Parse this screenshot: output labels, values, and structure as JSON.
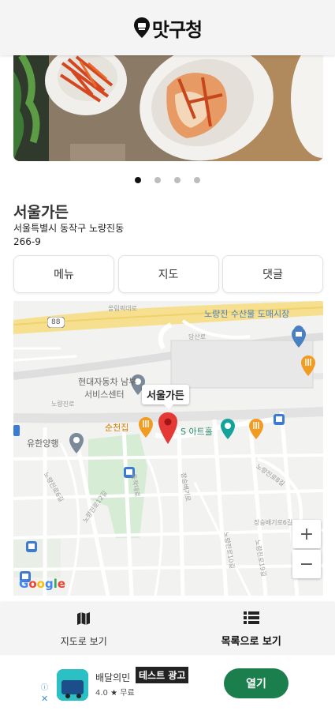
{
  "header": {
    "title": "맛구청"
  },
  "carousel": {
    "total": 4,
    "active_index": 0
  },
  "place": {
    "name": "서울가든",
    "address_line1": "서울특별시 동작구 노량진동",
    "address_line2": "266-9"
  },
  "tabs": [
    {
      "label": "메뉴"
    },
    {
      "label": "지도"
    },
    {
      "label": "댓글"
    }
  ],
  "map": {
    "marker_label": "서울가든",
    "labels": {
      "fish_market": "노량진 수산물 도매시장",
      "service_center_1": "현대자동차 남부",
      "service_center_2": "서비스센터",
      "suncheon": "순천집",
      "arthall": "S 아트홀",
      "yuhan": "유한양행",
      "olympic": "올림픽대로",
      "route": "88",
      "roads": [
        "노량진로",
        "동작대로",
        "노량진로12길",
        "노량진로6길",
        "장승배기로",
        "장승배기로6길",
        "노량진로8길",
        "노량진로19길",
        "노량진로10길",
        "당산로"
      ]
    },
    "zoom_in": "+",
    "zoom_out": "−",
    "attribution": "Google"
  },
  "bottom_nav": {
    "map_view": "지도로 보기",
    "list_view": "목록으로 보기",
    "active": "list_view"
  },
  "ad": {
    "app_name": "배달의민",
    "rating": "4.0",
    "price": "무료",
    "test_badge": "테스트 광고",
    "cta": "열기"
  },
  "colors": {
    "header_bg": "#f4f4f4",
    "ad_cta": "#1b7f4d",
    "marker": "#e53935",
    "map_road_major": "#f9e08c",
    "map_water_label": "#4a7fc1"
  }
}
